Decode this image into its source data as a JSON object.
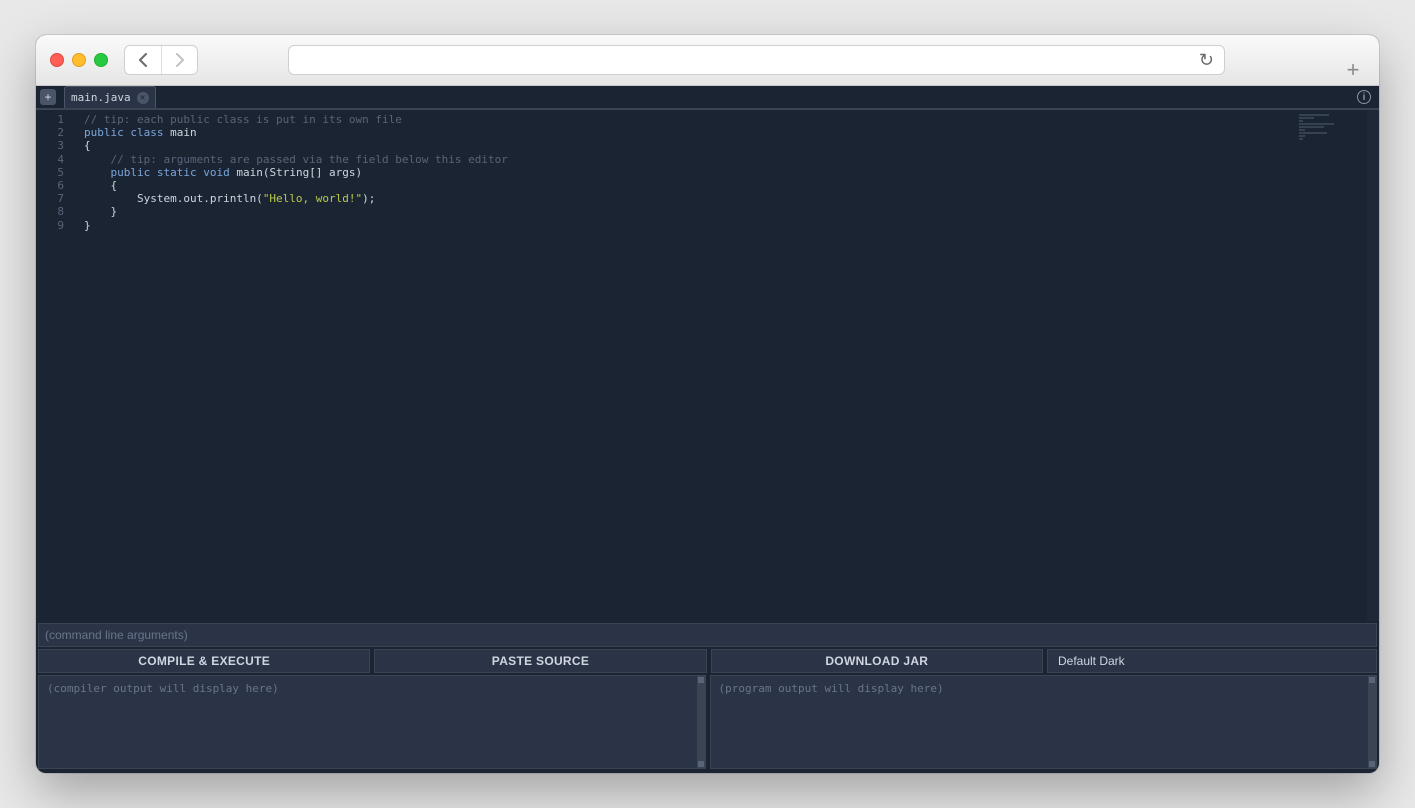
{
  "colors": {
    "bg": "#1b2433",
    "panel": "#2a3446",
    "border": "#3b4453",
    "text": "#d0d6e0",
    "muted": "#6a758c",
    "keyword": "#7aa6da",
    "string": "#b9ca4a",
    "comment": "#5a6478"
  },
  "browser": {
    "url": "",
    "back_enabled": true,
    "forward_enabled": false
  },
  "tabs": {
    "add_label": "+",
    "file_name": "main.java",
    "info_label": "i"
  },
  "editor": {
    "line_numbers": [
      "1",
      "2",
      "3",
      "4",
      "5",
      "6",
      "7",
      "8",
      "9"
    ],
    "lines": [
      {
        "type": "comment",
        "indent": 0,
        "text": "// tip: each public class is put in its own file"
      },
      {
        "type": "decl",
        "indent": 0,
        "kw": "public class",
        "rest": " main"
      },
      {
        "type": "plain",
        "indent": 0,
        "text": "{"
      },
      {
        "type": "comment",
        "indent": 1,
        "text": "// tip: arguments are passed via the field below this editor"
      },
      {
        "type": "method",
        "indent": 1,
        "kw": "public static void",
        "rest": " main(String[] args)"
      },
      {
        "type": "plain",
        "indent": 1,
        "text": "{"
      },
      {
        "type": "print",
        "indent": 2,
        "pre": "System.out.println(",
        "str": "\"Hello, world!\"",
        "post": ");"
      },
      {
        "type": "plain",
        "indent": 1,
        "text": "}"
      },
      {
        "type": "plain",
        "indent": 0,
        "text": "}"
      }
    ]
  },
  "cmd_placeholder": "(command line arguments)",
  "buttons": {
    "compile": "COMPILE & EXECUTE",
    "paste": "PASTE SOURCE",
    "download": "DOWNLOAD JAR",
    "theme": "Default Dark"
  },
  "output": {
    "compiler_placeholder": "(compiler output will display here)",
    "program_placeholder": "(program output will display here)"
  }
}
